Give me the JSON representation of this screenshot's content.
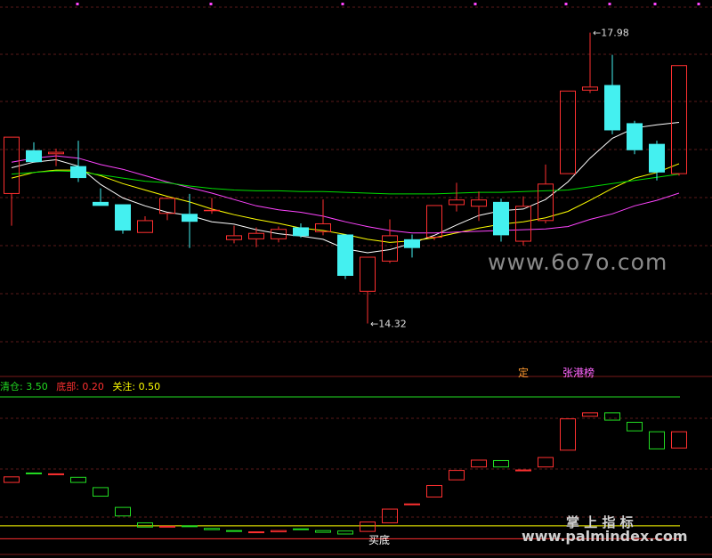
{
  "chart_data": {
    "type": "candlestick",
    "main_pane": {
      "ylim": [
        13.8,
        18.3
      ],
      "candles": [
        {
          "o": 15.95,
          "h": 16.4,
          "l": 15.55,
          "c": 16.67
        },
        {
          "o": 16.5,
          "h": 16.6,
          "l": 16.35,
          "c": 16.35
        },
        {
          "o": 16.45,
          "h": 16.52,
          "l": 16.3,
          "c": 16.48
        },
        {
          "o": 16.3,
          "h": 16.62,
          "l": 16.1,
          "c": 16.15
        },
        {
          "o": 15.85,
          "h": 16.02,
          "l": 15.8,
          "c": 15.8
        },
        {
          "o": 15.82,
          "h": 15.82,
          "l": 15.45,
          "c": 15.49
        },
        {
          "o": 15.46,
          "h": 15.67,
          "l": 15.46,
          "c": 15.62
        },
        {
          "o": 15.7,
          "h": 15.9,
          "l": 15.62,
          "c": 15.9
        },
        {
          "o": 15.7,
          "h": 15.95,
          "l": 15.27,
          "c": 15.6
        },
        {
          "o": 15.75,
          "h": 15.9,
          "l": 15.7,
          "c": 15.75
        },
        {
          "o": 15.37,
          "h": 15.55,
          "l": 15.33,
          "c": 15.43
        },
        {
          "o": 15.38,
          "h": 15.53,
          "l": 15.28,
          "c": 15.46
        },
        {
          "o": 15.38,
          "h": 15.54,
          "l": 15.34,
          "c": 15.51
        },
        {
          "o": 15.53,
          "h": 15.58,
          "l": 15.4,
          "c": 15.42
        },
        {
          "o": 15.47,
          "h": 15.88,
          "l": 15.43,
          "c": 15.58
        },
        {
          "o": 15.44,
          "h": 15.44,
          "l": 14.88,
          "c": 14.92
        },
        {
          "o": 14.72,
          "h": 15.13,
          "l": 14.32,
          "c": 15.16
        },
        {
          "o": 15.1,
          "h": 15.63,
          "l": 15.08,
          "c": 15.43
        },
        {
          "o": 15.38,
          "h": 15.44,
          "l": 15.15,
          "c": 15.27
        },
        {
          "o": 15.4,
          "h": 15.8,
          "l": 15.37,
          "c": 15.81
        },
        {
          "o": 15.81,
          "h": 16.09,
          "l": 15.73,
          "c": 15.88
        },
        {
          "o": 15.79,
          "h": 15.98,
          "l": 15.61,
          "c": 15.88
        },
        {
          "o": 15.85,
          "h": 15.89,
          "l": 15.35,
          "c": 15.43
        },
        {
          "o": 15.35,
          "h": 15.92,
          "l": 15.3,
          "c": 15.8
        },
        {
          "o": 15.61,
          "h": 16.32,
          "l": 15.58,
          "c": 16.08
        },
        {
          "o": 16.2,
          "h": 17.25,
          "l": 16.2,
          "c": 17.25
        },
        {
          "o": 17.25,
          "h": 17.98,
          "l": 17.22,
          "c": 17.3
        },
        {
          "o": 17.32,
          "h": 17.7,
          "l": 16.7,
          "c": 16.75
        },
        {
          "o": 16.84,
          "h": 16.87,
          "l": 16.45,
          "c": 16.5
        },
        {
          "o": 16.58,
          "h": 16.62,
          "l": 16.12,
          "c": 16.22
        },
        {
          "o": 16.2,
          "h": 17.57,
          "l": 16.18,
          "c": 17.57
        }
      ],
      "ma_lines": [
        {
          "color": "#ffffff",
          "values": [
            16.28,
            16.35,
            16.38,
            16.3,
            16.07,
            15.9,
            15.8,
            15.72,
            15.68,
            15.6,
            15.57,
            15.5,
            15.45,
            15.42,
            15.38,
            15.26,
            15.21,
            15.25,
            15.33,
            15.43,
            15.56,
            15.68,
            15.74,
            15.76,
            15.88,
            16.1,
            16.4,
            16.65,
            16.78,
            16.82,
            16.85
          ]
        },
        {
          "color": "#ffff00",
          "values": [
            16.15,
            16.22,
            16.25,
            16.25,
            16.18,
            16.08,
            16.0,
            15.92,
            15.85,
            15.76,
            15.69,
            15.63,
            15.58,
            15.52,
            15.49,
            15.44,
            15.38,
            15.34,
            15.36,
            15.4,
            15.46,
            15.52,
            15.57,
            15.6,
            15.65,
            15.73,
            15.87,
            16.02,
            16.15,
            16.22,
            16.33
          ]
        },
        {
          "color": "#ff44ff",
          "values": [
            16.35,
            16.4,
            16.43,
            16.4,
            16.32,
            16.26,
            16.18,
            16.1,
            16.03,
            15.96,
            15.88,
            15.8,
            15.75,
            15.72,
            15.67,
            15.6,
            15.54,
            15.49,
            15.46,
            15.46,
            15.47,
            15.48,
            15.49,
            15.5,
            15.51,
            15.54,
            15.63,
            15.7,
            15.8,
            15.87,
            15.96
          ]
        },
        {
          "color": "#00dd00",
          "values": [
            16.2,
            16.22,
            16.24,
            16.23,
            16.19,
            16.15,
            16.11,
            16.09,
            16.05,
            16.02,
            16.0,
            15.99,
            15.99,
            15.98,
            15.98,
            15.97,
            15.96,
            15.95,
            15.95,
            15.95,
            15.96,
            15.97,
            15.97,
            15.98,
            15.99,
            16.0,
            16.04,
            16.08,
            16.12,
            16.16,
            16.2
          ]
        }
      ],
      "annotations": [
        {
          "text": "17.98",
          "value": 17.98,
          "candle": 26
        },
        {
          "text": "14.32",
          "value": 14.32,
          "candle": 16
        }
      ]
    },
    "indicator_pane": {
      "ylim": [
        0.0,
        3.5
      ],
      "lines": [
        {
          "name": "清仓",
          "value": 3.5,
          "color": "#22dd22"
        },
        {
          "name": "底部",
          "value": 0.2,
          "color": "#ff3030"
        },
        {
          "name": "关注",
          "value": 0.5,
          "color": "#ffff00"
        }
      ],
      "boxes": [
        {
          "o": 1.5,
          "c": 1.65
        },
        {
          "o": 1.72,
          "c": 1.7
        },
        {
          "o": 1.7,
          "c": 1.7
        },
        {
          "o": 1.64,
          "c": 1.5
        },
        {
          "o": 1.4,
          "c": 1.18
        },
        {
          "o": 0.94,
          "c": 0.72
        },
        {
          "o": 0.58,
          "c": 0.46
        },
        {
          "o": 0.48,
          "c": 0.48
        },
        {
          "o": 0.49,
          "c": 0.46
        },
        {
          "o": 0.45,
          "c": 0.4
        },
        {
          "o": 0.38,
          "c": 0.36
        },
        {
          "o": 0.35,
          "c": 0.35
        },
        {
          "o": 0.35,
          "c": 0.4
        },
        {
          "o": 0.42,
          "c": 0.38
        },
        {
          "o": 0.4,
          "c": 0.34
        },
        {
          "o": 0.39,
          "c": 0.3
        },
        {
          "o": 0.36,
          "c": 0.6
        },
        {
          "o": 0.56,
          "c": 0.9
        },
        {
          "o": 0.96,
          "c": 1.0
        },
        {
          "o": 1.16,
          "c": 1.45
        },
        {
          "o": 1.56,
          "c": 1.8
        },
        {
          "o": 1.86,
          "c": 2.04
        },
        {
          "o": 2.03,
          "c": 1.86
        },
        {
          "o": 1.76,
          "c": 1.79
        },
        {
          "o": 1.86,
          "c": 2.1
        },
        {
          "o": 2.25,
          "c": 3.0
        },
        {
          "o": 3.04,
          "c": 3.14
        },
        {
          "o": 3.14,
          "c": 2.95
        },
        {
          "o": 2.92,
          "c": 2.7
        },
        {
          "o": 2.7,
          "c": 2.28
        },
        {
          "o": 2.3,
          "c": 2.7
        }
      ]
    }
  },
  "signals": {
    "main": [
      {
        "text": "定",
        "candle": 23
      },
      {
        "text": "张港榜",
        "candle": 25
      }
    ],
    "indicator": [
      {
        "text": "买底",
        "candle": 16
      }
    ]
  },
  "legend": {
    "items": [
      {
        "label": "清仓: 3.50",
        "color": "#22dd22"
      },
      {
        "label": "底部: 0.20",
        "color": "#ff3030"
      },
      {
        "label": "关注: 0.50",
        "color": "#ffff00"
      }
    ]
  },
  "watermarks": {
    "main": "www.6o7o.com",
    "title": "掌 上 指 标",
    "url": "www.palmindex.com"
  },
  "colors": {
    "up": "#ff3030",
    "down": "#44f0f0",
    "ind_up": "#ff3030",
    "ind_down": "#22dd22",
    "grid": "#5a1a1a",
    "axis_marker": "#ff44ff"
  }
}
